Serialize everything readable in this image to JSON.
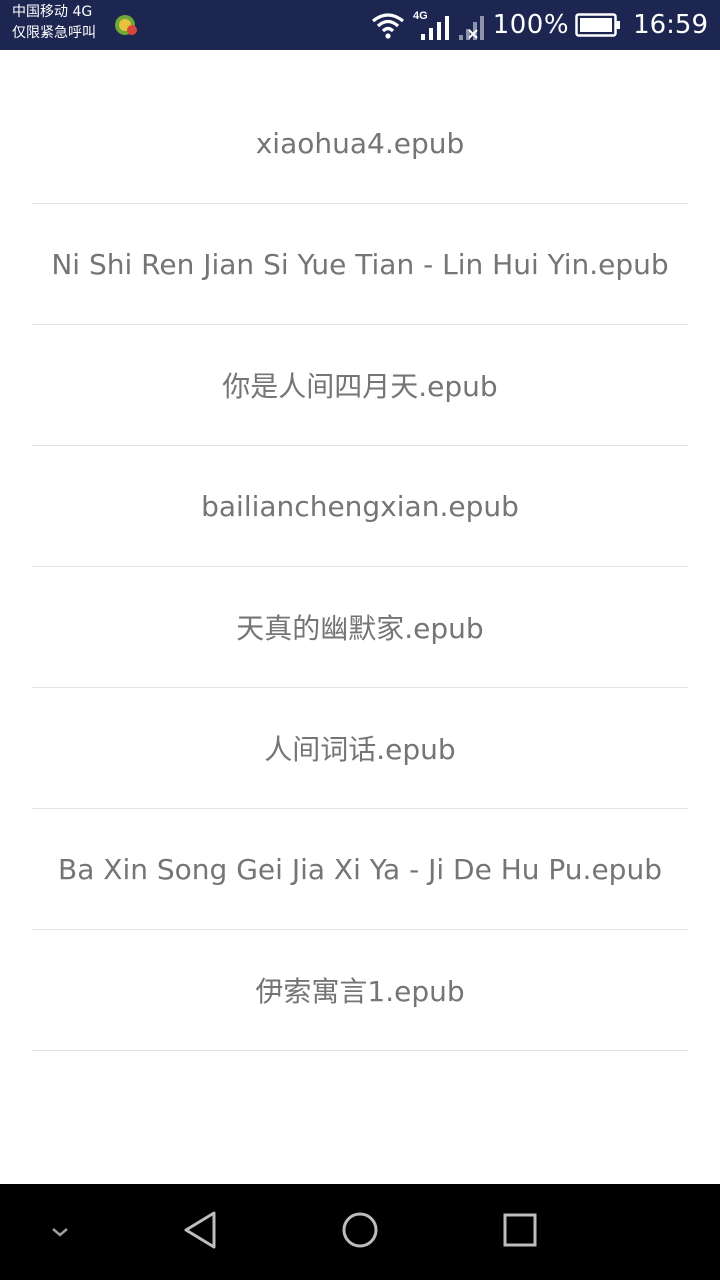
{
  "status_bar": {
    "carrier_line1": "中国移动 4G",
    "carrier_line2": "仅限紧急呼叫",
    "network_label": "4G",
    "battery_percent": "100%",
    "time": "16:59",
    "icons": [
      "app-notification-icon",
      "wifi-icon",
      "cellular-signal-icon",
      "no-sim-signal-icon",
      "battery-icon"
    ]
  },
  "files": [
    "xiaohua4.epub",
    "Ni Shi Ren Jian Si Yue Tian - Lin Hui Yin.epub",
    "你是人间四月天.epub",
    "bailianchengxian.epub",
    "天真的幽默家.epub",
    "人间词话.epub",
    "Ba Xin Song Gei Jia Xi Ya - Ji De Hu Pu.epub",
    "伊索寓言1.epub"
  ],
  "nav_bar": {
    "icons": [
      "hide-nav-icon",
      "back-icon",
      "home-icon",
      "recents-icon"
    ]
  },
  "colors": {
    "status_bar_bg": "#1d2651",
    "item_text": "#757575",
    "divider": "#e3e3e3",
    "nav_bar_bg": "#000000"
  }
}
